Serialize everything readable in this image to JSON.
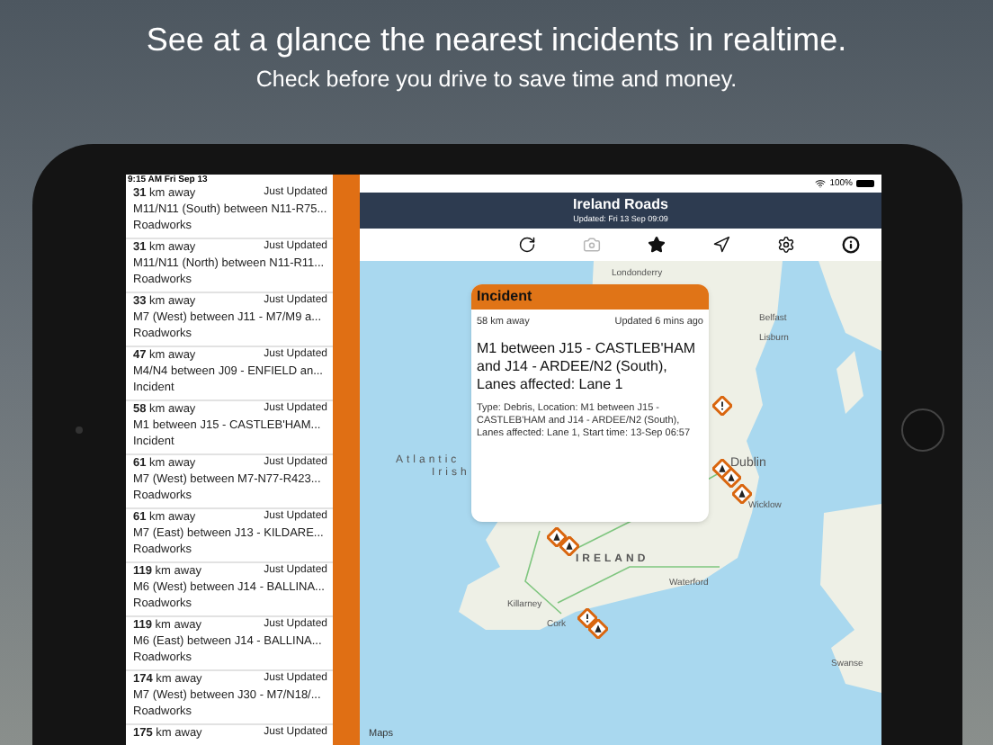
{
  "headline": "See at a glance the nearest incidents in realtime.",
  "subheadline": "Check before you drive to save time and money.",
  "status_bar": {
    "time": "9:15 AM  Fri Sep 13",
    "battery": "100%"
  },
  "incidents": [
    {
      "distance": "**31** km away",
      "updated": "Just Updated",
      "title": "M11/N11 (South) between N11-R75...",
      "type": "Roadworks"
    },
    {
      "distance": "**31** km away",
      "updated": "Just Updated",
      "title": "M11/N11 (North) between N11-R11...",
      "type": "Roadworks"
    },
    {
      "distance": "**33** km away",
      "updated": "Just Updated",
      "title": "M7 (West) between J11 - M7/M9 a...",
      "type": "Roadworks"
    },
    {
      "distance": "**47** km away",
      "updated": "Just Updated",
      "title": "M4/N4 between J09 - ENFIELD an...",
      "type": "Incident"
    },
    {
      "distance": "**58** km away",
      "updated": "Just Updated",
      "title": "M1 between J15 - CASTLEB'HAM...",
      "type": "Incident"
    },
    {
      "distance": "**61** km away",
      "updated": "Just Updated",
      "title": "M7 (West) between M7-N77-R423...",
      "type": "Roadworks"
    },
    {
      "distance": "**61** km away",
      "updated": "Just Updated",
      "title": "M7 (East) between J13 - KILDARE...",
      "type": "Roadworks"
    },
    {
      "distance": "**119** km away",
      "updated": "Just Updated",
      "title": "M6 (West) between J14 - BALLINA...",
      "type": "Roadworks"
    },
    {
      "distance": "**119** km away",
      "updated": "Just Updated",
      "title": "M6 (East) between J14 - BALLINA...",
      "type": "Roadworks"
    },
    {
      "distance": "**174** km away",
      "updated": "Just Updated",
      "title": "M7 (West) between J30 - M7/N18/...",
      "type": "Roadworks"
    },
    {
      "distance": "**175** km away",
      "updated": "Just Updated"
    }
  ],
  "app_bar": {
    "title": "Ireland Roads",
    "subtitle": "Updated: Fri 13 Sep 09:09"
  },
  "toolbar": [
    {
      "kind": "refresh",
      "disabled": false
    },
    {
      "kind": "camera",
      "disabled": true
    },
    {
      "kind": "star",
      "disabled": false
    },
    {
      "kind": "locate",
      "disabled": false
    },
    {
      "kind": "settings",
      "disabled": false
    },
    {
      "kind": "info",
      "disabled": false
    }
  ],
  "map_labels": [
    "Londonderry",
    "Belfast",
    "Lisburn",
    "Atlantic",
    "Irish",
    "Dublin",
    "Wicklow",
    "IRELAND",
    "Waterford",
    "Killarney",
    "Cork",
    "Swanse"
  ],
  "popup": {
    "heading": "Incident",
    "distance": "58 km away",
    "updated": "Updated 6 mins ago",
    "title": "M1 between J15 - CASTLEB'HAM and J14 - ARDEE/N2 (South), Lanes affected: Lane 1",
    "details": "Type: Debris, Location: M1 between J15 - CASTLEB'HAM and J14 - ARDEE/N2 (South), Lanes affected: Lane 1, Start time: 13-Sep 06:57"
  },
  "map_credit": "Maps"
}
